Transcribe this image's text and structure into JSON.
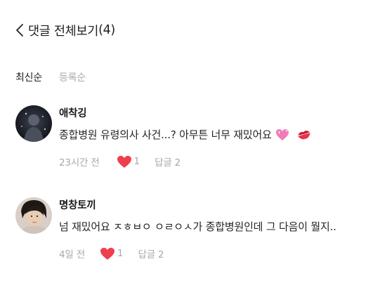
{
  "header": {
    "title": "댓글 전체보기",
    "count": "(4)"
  },
  "sort": {
    "tabs": [
      {
        "label": "최신순"
      },
      {
        "label": "등록순"
      }
    ]
  },
  "comments": [
    {
      "author": "애착깅",
      "text": "종합병원 유령의사 사건...? 아무튼 너무 재밌어요",
      "emojis": [
        "heart-emoji",
        "kiss-mark-emoji"
      ],
      "time": "23시간 전",
      "likes": "1",
      "reply_label": "답글 2"
    },
    {
      "author": "명창토끼",
      "text": "넘 재밌어요 ㅈㅎㅂㅇ ㅇㄹㅇㅅ가 종합병원인데 그 다음이 뭘지..",
      "time": "4일 전",
      "likes": "1",
      "reply_label": "답글 2"
    }
  ],
  "colors": {
    "like_heart": "#ef3f4f",
    "meta_text": "#a8a8a8",
    "inactive_tab": "#a9a9a9"
  }
}
